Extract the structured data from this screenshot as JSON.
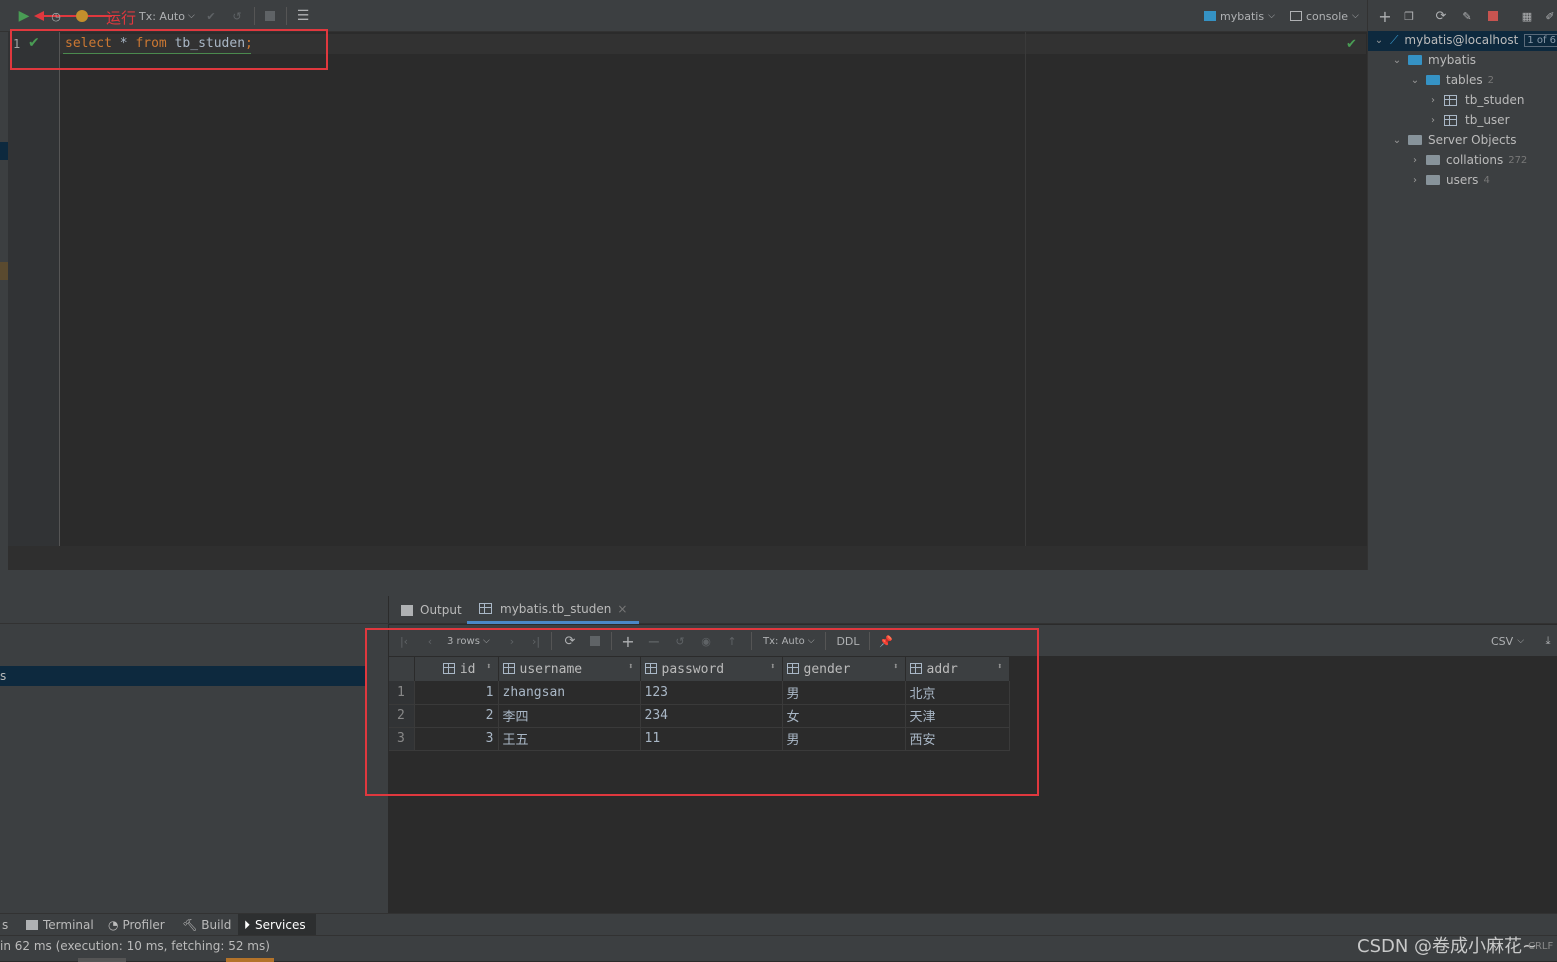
{
  "toolbar": {
    "tx_mode": "Tx: Auto",
    "annotation": "运行",
    "datasource": "mybatis",
    "console": "console"
  },
  "editor": {
    "line_number": "1",
    "sql_keyword1": "select",
    "sql_star": " * ",
    "sql_keyword2": "from",
    "sql_table": " tb_studen",
    "sql_semicolon": ";"
  },
  "db_panel": {
    "connection": "mybatis@localhost",
    "connection_badge": "1 of 6",
    "schema": "mybatis",
    "tables_label": "tables",
    "tables_count": "2",
    "table1": "tb_studen",
    "table2": "tb_user",
    "server_objects": "Server Objects",
    "collations": "collations",
    "collations_count": "272",
    "users": "users",
    "users_count": "4"
  },
  "services": {
    "left_item": "s",
    "tabs": {
      "output": "Output",
      "result": "mybatis.tb_studen"
    },
    "result_toolbar": {
      "rows": "3 rows",
      "tx_mode": "Tx: Auto",
      "ddl": "DDL",
      "export": "CSV"
    }
  },
  "grid": {
    "columns": [
      "id",
      "username",
      "password",
      "gender",
      "addr"
    ],
    "rows": [
      {
        "n": "1",
        "id": "1",
        "username": "zhangsan",
        "password": "123",
        "gender": "男",
        "addr": "北京"
      },
      {
        "n": "2",
        "id": "2",
        "username": "李四",
        "password": "234",
        "gender": "女",
        "addr": "天津"
      },
      {
        "n": "3",
        "id": "3",
        "username": "王五",
        "password": "11",
        "gender": "男",
        "addr": "西安"
      }
    ]
  },
  "tool_tabs": {
    "first": "s",
    "terminal": "Terminal",
    "profiler": "Profiler",
    "build": "Build",
    "services": "Services"
  },
  "status": {
    "message": "in 62 ms (execution: 10 ms, fetching: 52 ms)",
    "watermark": "CSDN @卷成小麻花~",
    "line_sep": "CRLF"
  },
  "colors": {
    "keyword": "#cc7832",
    "highlight_box": "#e0383e",
    "run_green": "#499c54",
    "selection": "#0d293e"
  }
}
